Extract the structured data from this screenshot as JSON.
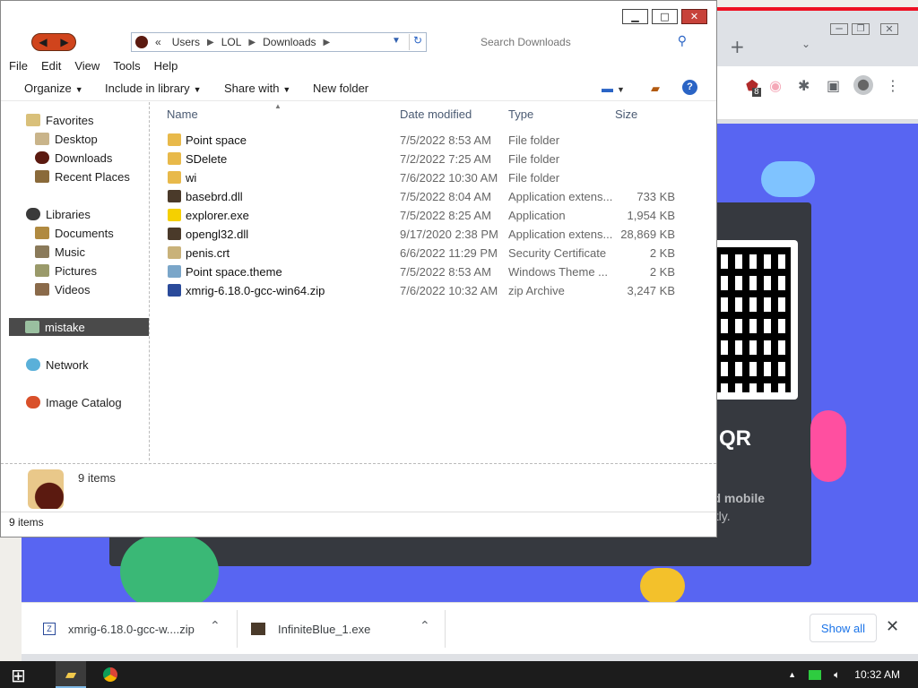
{
  "explorer": {
    "window_buttons": {
      "minimize": "▁",
      "maximize": "□",
      "close": "✕"
    },
    "nav": {
      "back": "◀",
      "forward": "▶"
    },
    "breadcrumb": [
      "Users",
      "LOL",
      "Downloads"
    ],
    "breadcrumb_prefix": "«",
    "search_placeholder": "Search Downloads",
    "menu": [
      "File",
      "Edit",
      "View",
      "Tools",
      "Help"
    ],
    "commands": {
      "organize": "Organize",
      "include": "Include in library",
      "share": "Share with",
      "new_folder": "New folder"
    },
    "navpane": {
      "favorites": "Favorites",
      "desktop": "Desktop",
      "downloads": "Downloads",
      "recent": "Recent Places",
      "libraries": "Libraries",
      "documents": "Documents",
      "music": "Music",
      "pictures": "Pictures",
      "videos": "Videos",
      "mistake": "mistake",
      "network": "Network",
      "image_catalog": "Image Catalog"
    },
    "columns": {
      "name": "Name",
      "date": "Date modified",
      "type": "Type",
      "size": "Size"
    },
    "files": [
      {
        "name": "Point space",
        "date": "7/5/2022 8:53 AM",
        "type": "File folder",
        "size": "",
        "icon": "folder",
        "color": "#e8b94a"
      },
      {
        "name": "SDelete",
        "date": "7/2/2022 7:25 AM",
        "type": "File folder",
        "size": "",
        "icon": "folder",
        "color": "#e8b94a"
      },
      {
        "name": "wi",
        "date": "7/6/2022 10:30 AM",
        "type": "File folder",
        "size": "",
        "icon": "folder",
        "color": "#e8b94a"
      },
      {
        "name": "basebrd.dll",
        "date": "7/5/2022 8:04 AM",
        "type": "Application extens...",
        "size": "733 KB",
        "icon": "dll",
        "color": "#4a3a2a"
      },
      {
        "name": "explorer.exe",
        "date": "7/5/2022 8:25 AM",
        "type": "Application",
        "size": "1,954 KB",
        "icon": "exe",
        "color": "#f5d000"
      },
      {
        "name": "opengl32.dll",
        "date": "9/17/2020 2:38 PM",
        "type": "Application extens...",
        "size": "28,869 KB",
        "icon": "dll",
        "color": "#4a3a2a"
      },
      {
        "name": "penis.crt",
        "date": "6/6/2022 11:29 PM",
        "type": "Security Certificate",
        "size": "2 KB",
        "icon": "cert",
        "color": "#c9b27a"
      },
      {
        "name": "Point space.theme",
        "date": "7/5/2022 8:53 AM",
        "type": "Windows Theme ...",
        "size": "2 KB",
        "icon": "theme",
        "color": "#7aa6c9"
      },
      {
        "name": "xmrig-6.18.0-gcc-win64.zip",
        "date": "7/6/2022 10:32 AM",
        "type": "zip Archive",
        "size": "3,247 KB",
        "icon": "zip",
        "color": "#2a4a9a"
      }
    ],
    "details_count": "9 items",
    "status_count": "9 items"
  },
  "browser": {
    "new_tab": "+",
    "qr_title": "QR",
    "qr_sub1": "rd mobile",
    "qr_sub2": "ntly.",
    "downloads": [
      {
        "name": "xmrig-6.18.0-gcc-w....zip"
      },
      {
        "name": "InfiniteBlue_1.exe"
      }
    ],
    "show_all": "Show all",
    "close": "✕",
    "badge": "8"
  },
  "taskbar": {
    "start": "⊞",
    "clock": "10:32 AM"
  },
  "colors": {
    "discord_bg": "#5865f2",
    "card_bg": "#36393f",
    "selected_nav": "#4a4a4a",
    "close_red": "#c7423a"
  }
}
